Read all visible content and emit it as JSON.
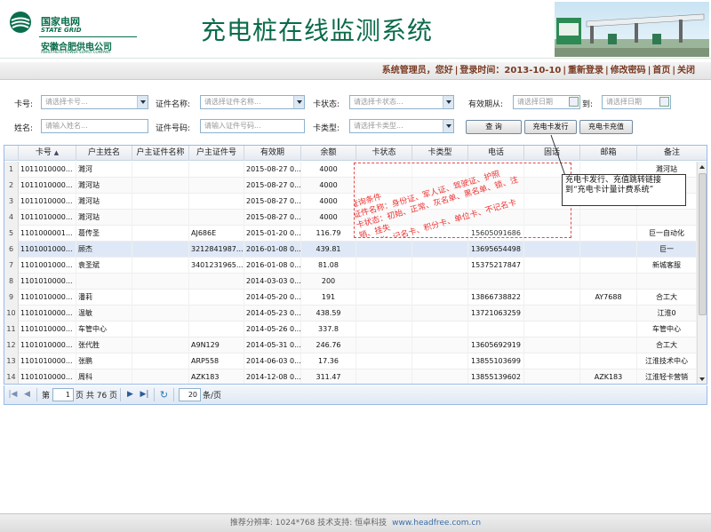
{
  "header": {
    "logo_cn": "国家电网",
    "logo_en": "STATE GRID",
    "company": "安徽合肥供电公司",
    "company_en": "ANHUI HEFEI POWER SUPPLY COMPANY",
    "title": "充电桩在线监测系统"
  },
  "user_bar": {
    "greeting": "系统管理员，您好",
    "login_time": "登录时间：2013-10-10",
    "links": [
      "重新登录",
      "修改密码",
      "首页",
      "关闭"
    ]
  },
  "filters": {
    "card_no": {
      "label": "卡号:",
      "placeholder": "请选择卡号..."
    },
    "id_name": {
      "label": "证件名称:",
      "placeholder": "请选择证件名称..."
    },
    "card_status": {
      "label": "卡状态:",
      "placeholder": "请选择卡状态..."
    },
    "valid_from": {
      "label": "有效期从:",
      "placeholder": "请选择日期"
    },
    "valid_to": {
      "label": "到:",
      "placeholder": "请选择日期"
    },
    "name": {
      "label": "姓名:",
      "placeholder": "请输入姓名..."
    },
    "id_no": {
      "label": "证件号码:",
      "placeholder": "请输入证件号码..."
    },
    "card_type": {
      "label": "卡类型:",
      "placeholder": "请选择卡类型..."
    },
    "buttons": {
      "query": "查 询",
      "issue": "充电卡发行",
      "recharge": "充电卡充值"
    }
  },
  "grid": {
    "columns": [
      "卡号",
      "户主姓名",
      "户主证件名称",
      "户主证件号",
      "有效期",
      "余额",
      "卡状态",
      "卡类型",
      "电话",
      "固话",
      "邮箱",
      "备注"
    ],
    "rows": [
      [
        "1011010000...",
        "濉河",
        "",
        "",
        "2015-08-27 0...",
        "4000",
        "",
        "",
        "",
        "",
        "",
        "濉河站"
      ],
      [
        "1011010000...",
        "濉河站",
        "",
        "",
        "2015-08-27 0...",
        "4000",
        "",
        "",
        "",
        "",
        "",
        "濉河站"
      ],
      [
        "1011010000...",
        "濉河站",
        "",
        "",
        "2015-08-27 0...",
        "4000",
        "",
        "",
        "",
        "",
        "",
        "濉河站"
      ],
      [
        "1011010000...",
        "濉河站",
        "",
        "",
        "2015-08-27 0...",
        "4000",
        "",
        "",
        "",
        "",
        "",
        ""
      ],
      [
        "1101000001...",
        "葛传圣",
        "",
        "AJ686E",
        "2015-01-20 0...",
        "116.79",
        "",
        "",
        "15605091686",
        "",
        "",
        "巨一自动化"
      ],
      [
        "1101001000...",
        "顾杰",
        "",
        "3212841987...",
        "2016-01-08 0...",
        "439.81",
        "",
        "",
        "13695654498",
        "",
        "",
        "巨一"
      ],
      [
        "1101001000...",
        "袁圣斌",
        "",
        "3401231965...",
        "2016-01-08 0...",
        "81.08",
        "",
        "",
        "15375217847",
        "",
        "",
        "新城客服"
      ],
      [
        "1101010000...",
        "",
        "",
        "",
        "2014-03-03 0...",
        "200",
        "",
        "",
        "",
        "",
        "",
        ""
      ],
      [
        "1101010000...",
        "潘莉",
        "",
        "",
        "2014-05-20 0...",
        "191",
        "",
        "",
        "13866738822",
        "",
        "AY7688",
        "合工大"
      ],
      [
        "1101010000...",
        "温敏",
        "",
        "",
        "2014-05-23 0...",
        "438.59",
        "",
        "",
        "13721063259",
        "",
        "",
        "江淮0"
      ],
      [
        "1101010000...",
        "车管中心",
        "",
        "",
        "2014-05-26 0...",
        "337.8",
        "",
        "",
        "",
        "",
        "",
        "车管中心"
      ],
      [
        "1101010000...",
        "张代胜",
        "",
        "A9N129",
        "2014-05-31 0...",
        "246.76",
        "",
        "",
        "13605692919",
        "",
        "",
        "合工大"
      ],
      [
        "1101010000...",
        "张鹏",
        "",
        "ARP558",
        "2014-06-03 0...",
        "17.36",
        "",
        "",
        "13855103699",
        "",
        "",
        "江淮技术中心"
      ],
      [
        "1101010000...",
        "周科",
        "",
        "AZK183",
        "2014-12-08 0...",
        "311.47",
        "",
        "",
        "13855139602",
        "",
        "AZK183",
        "江淮轻卡营销"
      ]
    ],
    "selected_row": 6
  },
  "pager": {
    "page_label": "第",
    "page": "1",
    "total": "页 共 76 页",
    "page_size": "20",
    "size_label": "条/页"
  },
  "annotations": {
    "query_note": [
      "查询条件",
      "证件名称：身份证、军人证、驾驶证、护照",
      "卡状态：初始、正常、灰名单、黑名单、锁、注",
      "销、挂失",
      "卡类型：记名卡、积分卡、单位卡、不记名卡"
    ],
    "callout": [
      "充电卡发行、充值跳转链接",
      "到“充电卡计量计费系统”"
    ]
  },
  "footer": {
    "text": "推荐分辨率: 1024*768   技术支持: 恒卓科技",
    "site": "www.headfree.com.cn"
  }
}
